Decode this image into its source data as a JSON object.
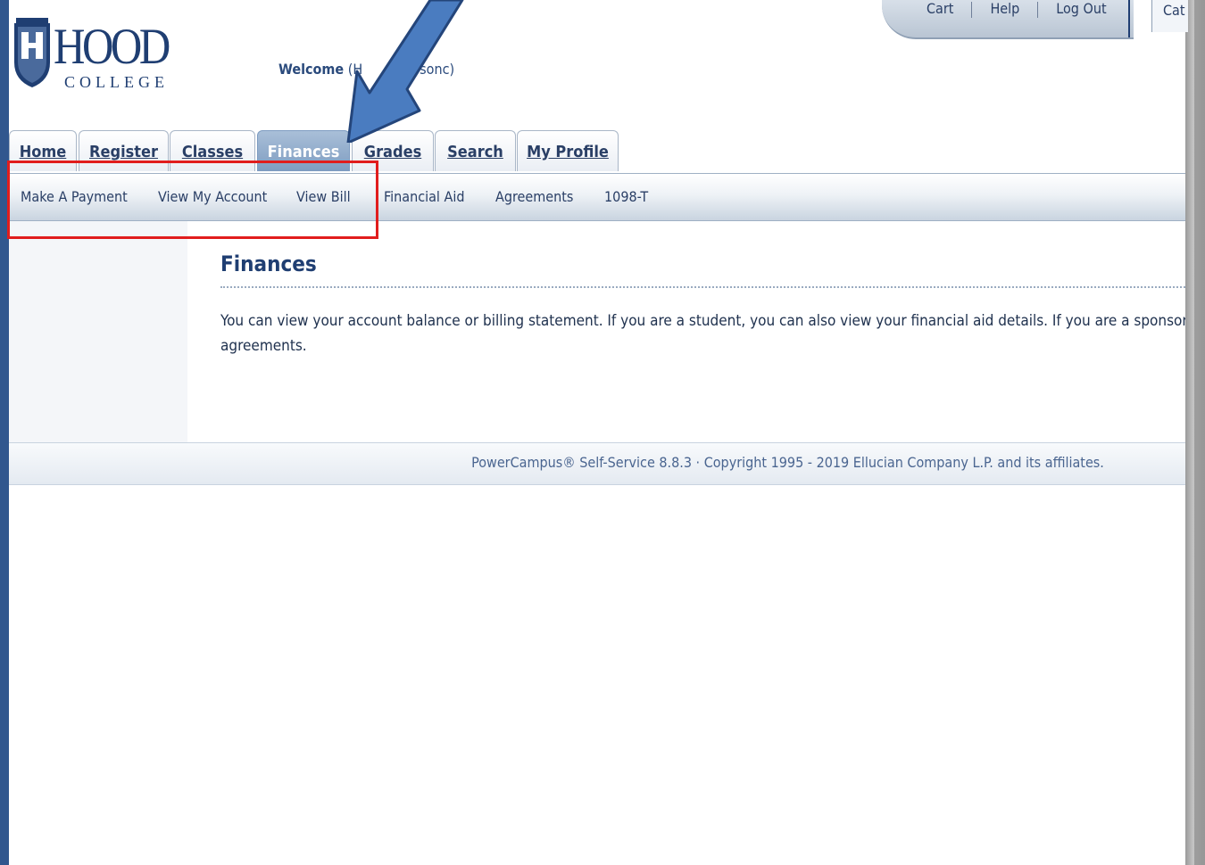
{
  "brand": {
    "logo_word": "HOOD",
    "logo_sub": "COLLEGE"
  },
  "header": {
    "welcome_label": "Welcome",
    "welcome_user": "(H",
    "welcome_user_tail": "dersonc)"
  },
  "utility_links": [
    "Cart",
    "Help",
    "Log Out"
  ],
  "utility_extra": "Cat",
  "tabs": [
    {
      "label": "Home"
    },
    {
      "label": "Register"
    },
    {
      "label": "Classes"
    },
    {
      "label": "Finances",
      "active": true
    },
    {
      "label": "Grades"
    },
    {
      "label": "Search"
    },
    {
      "label": "My Profile"
    }
  ],
  "subnav": [
    "Make A Payment",
    "View My Account",
    "View Bill",
    "Financial Aid",
    "Agreements",
    "1098-T"
  ],
  "content": {
    "title": "Finances",
    "line1": "You can view your account balance or billing statement. If you are a student, you can also view your financial aid details. If you are a sponsor, yo",
    "line2": "agreements."
  },
  "footer": {
    "text": "PowerCampus® Self-Service 8.8.3 · Copyright 1995 - 2019 Ellucian Company L.P. and its affiliates."
  },
  "colors": {
    "brand": "#1f3e72",
    "annotation_box": "#e11d1d",
    "annotation_arrow": "#4a7cc0"
  }
}
